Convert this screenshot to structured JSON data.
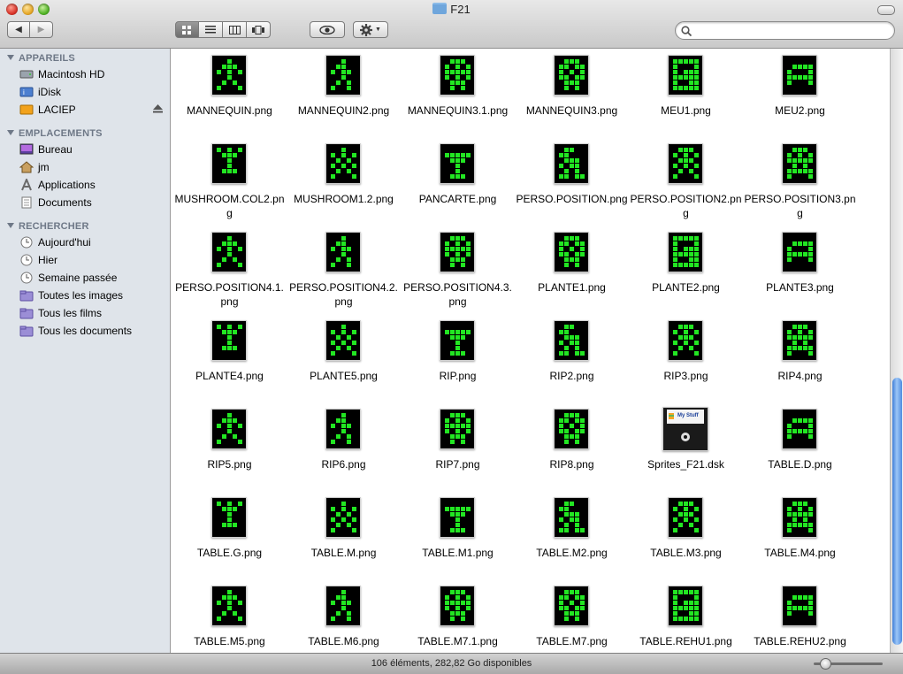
{
  "window": {
    "title": "F21"
  },
  "toolbar": {
    "back_icon": "left-triangle",
    "forward_icon": "right-triangle",
    "views": [
      "icon-view",
      "list-view",
      "column-view",
      "coverflow-view"
    ],
    "quicklook_icon": "eye-icon",
    "action_icon": "gear-icon",
    "search": {
      "value": "",
      "placeholder": ""
    }
  },
  "sidebar": {
    "sections": [
      {
        "title": "APPAREILS",
        "items": [
          {
            "label": "Macintosh HD",
            "icon": "hard-disk-icon"
          },
          {
            "label": "iDisk",
            "icon": "idisk-icon"
          },
          {
            "label": "LACIEP",
            "icon": "external-disk-icon"
          }
        ]
      },
      {
        "title": "EMPLACEMENTS",
        "items": [
          {
            "label": "Bureau",
            "icon": "desktop-icon"
          },
          {
            "label": "jm",
            "icon": "home-icon"
          },
          {
            "label": "Applications",
            "icon": "applications-icon"
          },
          {
            "label": "Documents",
            "icon": "documents-icon"
          }
        ]
      },
      {
        "title": "RECHERCHER",
        "items": [
          {
            "label": "Aujourd'hui",
            "icon": "clock-icon"
          },
          {
            "label": "Hier",
            "icon": "clock-icon"
          },
          {
            "label": "Semaine passée",
            "icon": "clock-icon"
          },
          {
            "label": "Toutes les images",
            "icon": "smart-folder-icon"
          },
          {
            "label": "Tous les films",
            "icon": "smart-folder-icon"
          },
          {
            "label": "Tous les documents",
            "icon": "smart-folder-icon"
          }
        ]
      }
    ]
  },
  "files": [
    {
      "name": "MANNEQUIN.png"
    },
    {
      "name": "MANNEQUIN2.png"
    },
    {
      "name": "MANNEQUIN3.1.png"
    },
    {
      "name": "MANNEQUIN3.png"
    },
    {
      "name": "MEU1.png"
    },
    {
      "name": "MEU2.png"
    },
    {
      "name": "MUSHROOM.COL2.png"
    },
    {
      "name": "MUSHROOM1.2.png"
    },
    {
      "name": "PANCARTE.png"
    },
    {
      "name": "PERSO.POSITION.png"
    },
    {
      "name": "PERSO.POSITION2.png"
    },
    {
      "name": "PERSO.POSITION3.png"
    },
    {
      "name": "PERSO.POSITION4.1.png"
    },
    {
      "name": "PERSO.POSITION4.2.png"
    },
    {
      "name": "PERSO.POSITION4.3.png"
    },
    {
      "name": "PLANTE1.png"
    },
    {
      "name": "PLANTE2.png"
    },
    {
      "name": "PLANTE3.png"
    },
    {
      "name": "PLANTE4.png"
    },
    {
      "name": "PLANTE5.png"
    },
    {
      "name": "RIP.png"
    },
    {
      "name": "RIP2.png"
    },
    {
      "name": "RIP3.png"
    },
    {
      "name": "RIP4.png"
    },
    {
      "name": "RIP5.png"
    },
    {
      "name": "RIP6.png"
    },
    {
      "name": "RIP7.png"
    },
    {
      "name": "RIP8.png"
    },
    {
      "name": "Sprites_F21.dsk",
      "kind": "disk",
      "disk_label": "My Stuff"
    },
    {
      "name": "TABLE.D.png"
    },
    {
      "name": "TABLE.G.png"
    },
    {
      "name": "TABLE.M.png"
    },
    {
      "name": "TABLE.M1.png"
    },
    {
      "name": "TABLE.M2.png"
    },
    {
      "name": "TABLE.M3.png"
    },
    {
      "name": "TABLE.M4.png"
    },
    {
      "name": "TABLE.M5.png"
    },
    {
      "name": "TABLE.M6.png"
    },
    {
      "name": "TABLE.M7.1.png"
    },
    {
      "name": "TABLE.M7.png"
    },
    {
      "name": "TABLE.REHU1.png"
    },
    {
      "name": "TABLE.REHU2.png"
    }
  ],
  "status": {
    "text": "106 éléments, 282,82 Go disponibles"
  },
  "colors": {
    "sprite_green": "#22e622",
    "sidebar_bg": "#dfe4ea",
    "scroll_thumb": "#4f8ce0"
  }
}
